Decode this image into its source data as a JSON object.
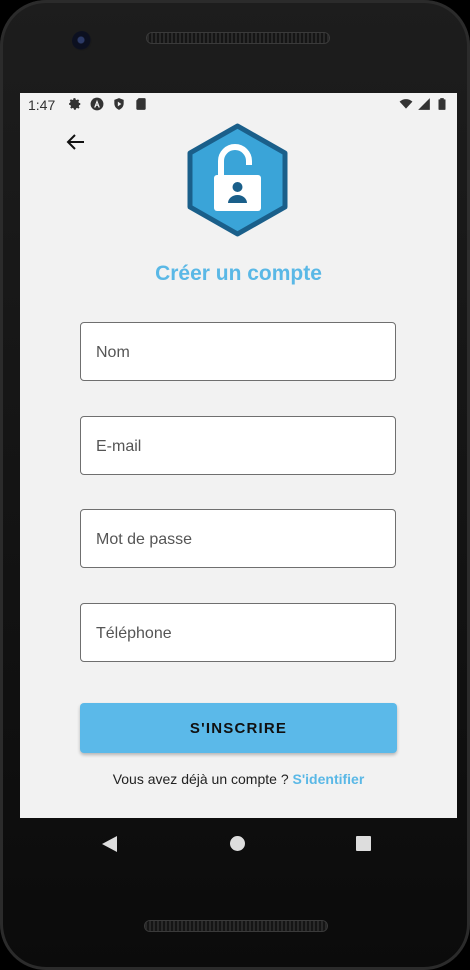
{
  "statusbar": {
    "time": "1:47",
    "left_icons": [
      "settings-icon",
      "a-icon",
      "shield-icon",
      "sd-card-icon"
    ],
    "right_icons": [
      "wifi-icon",
      "signal-icon",
      "battery-icon"
    ]
  },
  "header": {
    "back_icon": "arrow-left-icon",
    "logo_icon": "padlock-user-icon",
    "title": "Créer un compte"
  },
  "form": {
    "name_placeholder": "Nom",
    "email_placeholder": "E-mail",
    "password_placeholder": "Mot de passe",
    "phone_placeholder": "Téléphone",
    "submit_label": "S'INSCRIRE"
  },
  "footer": {
    "prompt": "Vous avez déjà un compte ? ",
    "link": "S'identifier"
  },
  "colors": {
    "accent": "#5ab8e6",
    "button": "#5bb9e9",
    "logo_fill": "#3aa4d8",
    "logo_border": "#1a5f8a",
    "background": "#f2f2f2"
  }
}
